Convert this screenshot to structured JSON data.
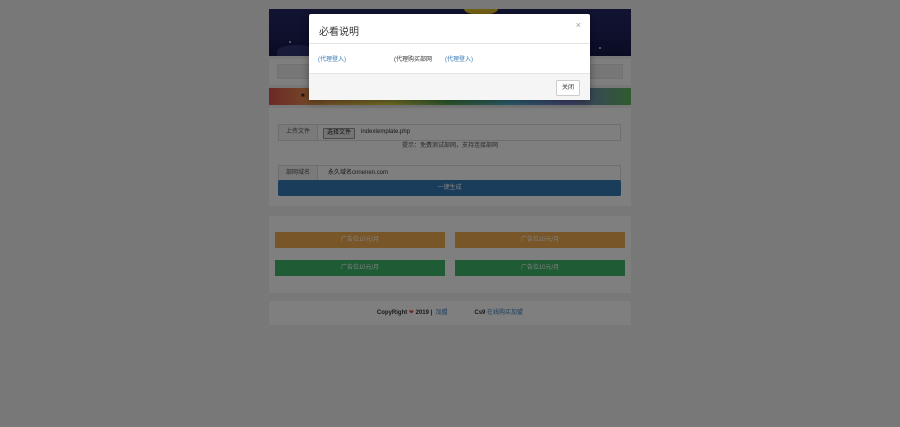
{
  "upload": {
    "file_label": "上传文件",
    "file_button": "选择文件",
    "file_name": "indextemplate.php",
    "hint": "提示：免费测试部网，支持连接部网",
    "domain_label": "部网域名",
    "domain_value": "永久域名cnnenen.com",
    "submit": "一键生成"
  },
  "ads": [
    "广告位10元/月",
    "广告位10元/月",
    "广告位10元/月",
    "广告位10元/月"
  ],
  "footer": {
    "copyright": "CopyRight",
    "year": "2019 |",
    "link1": "加盟",
    "cs_label": "Cs9",
    "link2": "在线购买加盟"
  },
  "modal": {
    "title": "必看说明",
    "close_icon": "×",
    "link1": "(代理登入)",
    "plain": "(代理购买部网",
    "link2": "(代理登入)",
    "close_button": "关闭"
  }
}
